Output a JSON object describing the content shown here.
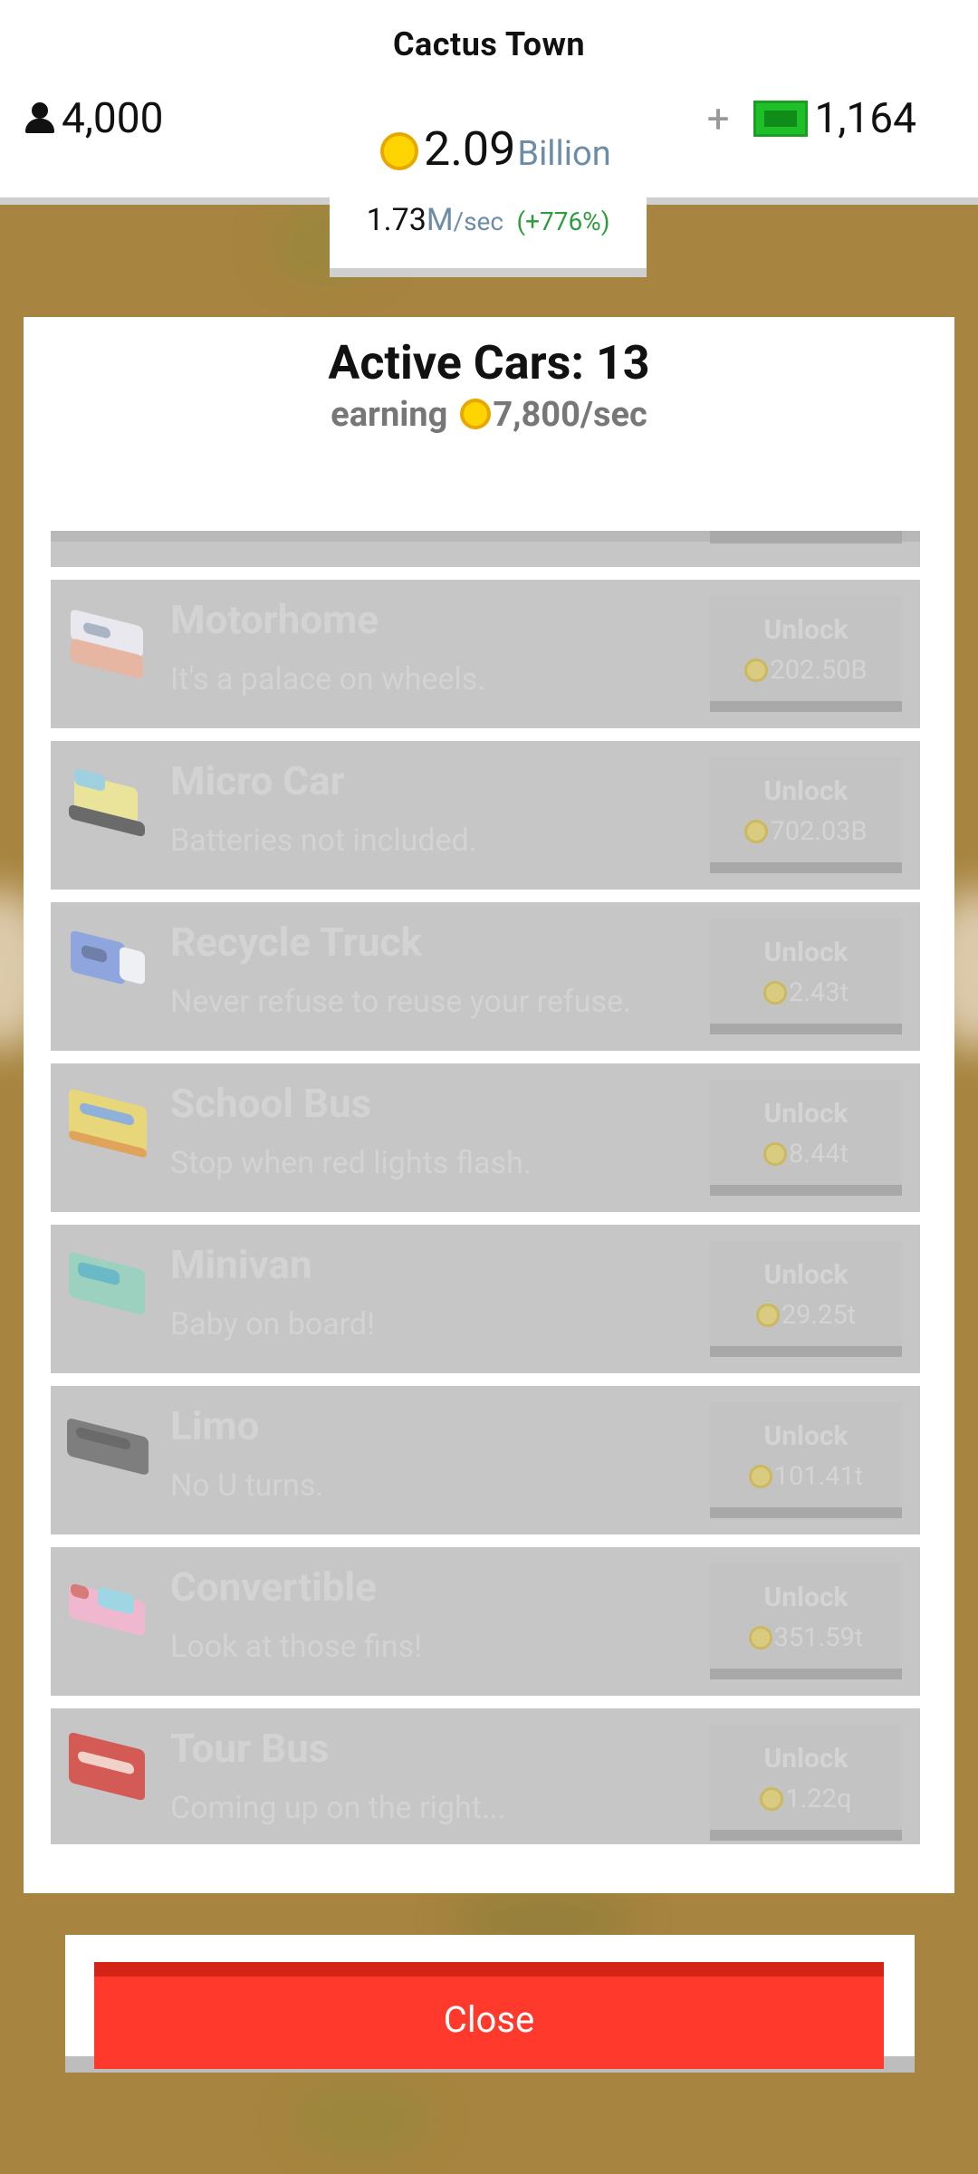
{
  "header": {
    "town_name": "Cactus Town",
    "population": "4,000",
    "coins_amount": "2.09",
    "coins_unit": "Billion",
    "cash_plus": "+",
    "cash_amount": "1,164",
    "rate_value": "1.73",
    "rate_unit": "M",
    "rate_suffix": "/sec",
    "rate_boost": "(+776%)"
  },
  "panel": {
    "title": "Active Cars: 13",
    "earning_label": "earning",
    "earning_value": "7,800/sec"
  },
  "cars": [
    {
      "name": "Motorhome",
      "desc": "It's a palace on wheels.",
      "unlock_label": "Unlock",
      "price": "202.50B",
      "icon": "motorhome-icon"
    },
    {
      "name": "Micro Car",
      "desc": "Batteries not included.",
      "unlock_label": "Unlock",
      "price": "702.03B",
      "icon": "micro-car-icon"
    },
    {
      "name": "Recycle Truck",
      "desc": "Never refuse to reuse your refuse.",
      "unlock_label": "Unlock",
      "price": "2.43t",
      "icon": "recycle-truck-icon"
    },
    {
      "name": "School Bus",
      "desc": "Stop when red lights flash.",
      "unlock_label": "Unlock",
      "price": "8.44t",
      "icon": "school-bus-icon"
    },
    {
      "name": "Minivan",
      "desc": "Baby on board!",
      "unlock_label": "Unlock",
      "price": "29.25t",
      "icon": "minivan-icon"
    },
    {
      "name": "Limo",
      "desc": "No U turns.",
      "unlock_label": "Unlock",
      "price": "101.41t",
      "icon": "limo-icon"
    },
    {
      "name": "Convertible",
      "desc": "Look at those fins!",
      "unlock_label": "Unlock",
      "price": "351.59t",
      "icon": "convertible-icon"
    },
    {
      "name": "Tour Bus",
      "desc": "Coming up on the right...",
      "unlock_label": "Unlock",
      "price": "1.22q",
      "icon": "tour-bus-icon"
    }
  ],
  "footer": {
    "close_label": "Close"
  },
  "colors": {
    "background": "#a7843f",
    "coin": "#ffd400",
    "cash": "#1fbf2a",
    "close_button": "#ff3a2d",
    "locked_row": "#c6c6c6"
  }
}
